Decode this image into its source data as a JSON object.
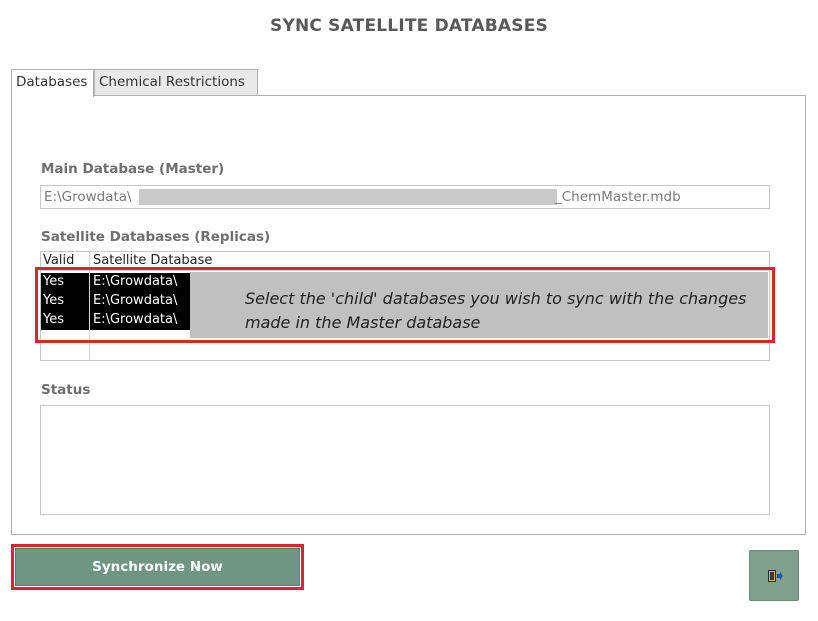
{
  "header": {
    "title": "SYNC SATELLITE DATABASES"
  },
  "tabs": [
    {
      "label": "Databases",
      "active": true
    },
    {
      "label": "Chemical Restrictions",
      "active": false
    }
  ],
  "main_database": {
    "label": "Main Database (Master)",
    "value_prefix": "E:\\Growdata\\",
    "value_suffix": "_ChemMaster.mdb"
  },
  "satellite_databases": {
    "label": "Satellite Databases (Replicas)",
    "columns": [
      "Valid",
      "Satellite Database"
    ],
    "rows": [
      {
        "valid": "Yes",
        "database": "E:\\Growdata\\"
      },
      {
        "valid": "Yes",
        "database": "E:\\Growdata\\"
      },
      {
        "valid": "Yes",
        "database": "E:\\Growdata\\"
      }
    ]
  },
  "callout": {
    "text": "Select the 'child' databases you wish to sync with the changes made in the Master database"
  },
  "status": {
    "label": "Status",
    "value": ""
  },
  "actions": {
    "sync_label": "Synchronize Now",
    "exit_icon": "exit-door-icon"
  },
  "colors": {
    "button_green": "#6f9682",
    "highlight_red": "#d9262c",
    "title_gray": "#595959"
  }
}
